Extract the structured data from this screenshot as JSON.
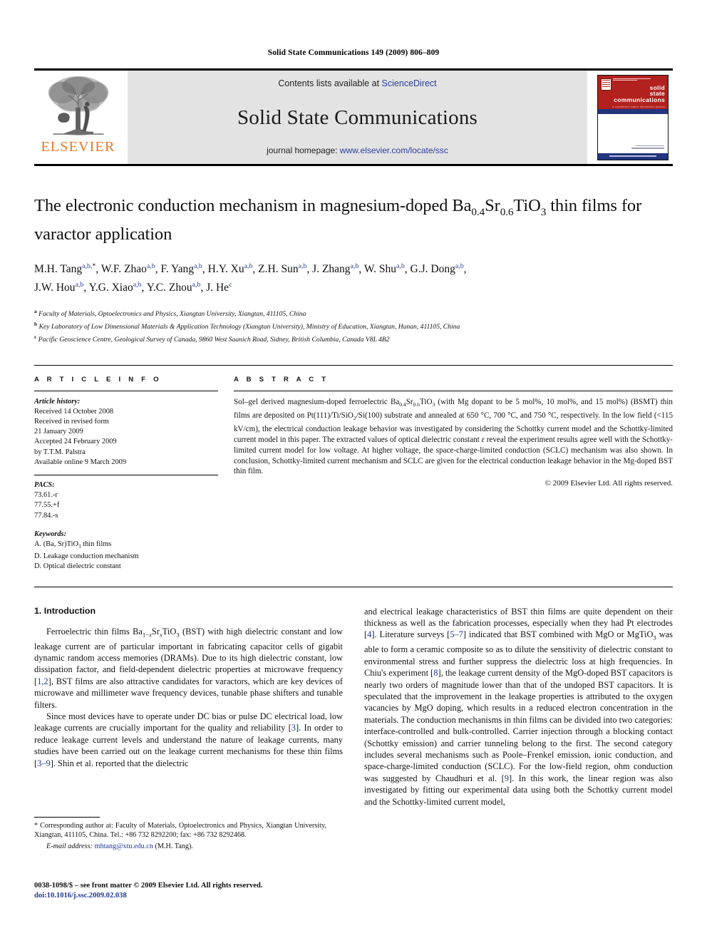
{
  "running_head": "Solid State Communications 149 (2009) 806–809",
  "masthead": {
    "contents_prefix": "Contents lists available at ",
    "contents_link": "ScienceDirect",
    "journal_name": "Solid State Communications",
    "homepage_prefix": "journal homepage: ",
    "homepage_link": "www.elsevier.com/locate/ssc",
    "publisher_logo_text": "ELSEVIER",
    "cover": {
      "line1": "solid",
      "line2": "state",
      "line3": "communications",
      "tagline": "a condensed matter information journal"
    }
  },
  "article": {
    "title_part1": "The electronic conduction mechanism in magnesium-doped Ba",
    "title_sub1": "0.4",
    "title_part2": "Sr",
    "title_sub2": "0.6",
    "title_part3": "TiO",
    "title_sub3": "3",
    "title_part4": " thin films for varactor application",
    "authors": "M.H. Tang a,b,*, W.F. Zhao a,b, F. Yang a,b, H.Y. Xu a,b, Z.H. Sun a,b, J. Zhang a,b, W. Shu a,b, G.J. Dong a,b, J.W. Hou a,b, Y.G. Xiao a,b, Y.C. Zhou a,b, J. He c",
    "affiliations": [
      {
        "marker": "a",
        "text": "Faculty of Materials, Optoelectronics and Physics, Xiangtan University, Xiangtan, 411105, China"
      },
      {
        "marker": "b",
        "text": "Key Laboratory of Low Dimensional Materials & Application Technology (Xiangtan University), Ministry of Education, Xiangtan, Hunan, 411105, China"
      },
      {
        "marker": "c",
        "text": "Pacific Geoscience Centre, Geological Survey of Canada, 9860 West Saanich Road, Sidney, British Columbia, Canada V8L 4B2"
      }
    ]
  },
  "info": {
    "heading": "A R T I C L E   I N F O",
    "history_label": "Article history:",
    "history_lines": [
      "Received 14 October 2008",
      "Received in revised form",
      "21 January 2009",
      "Accepted 24 February 2009",
      "by T.T.M. Palstra",
      "Available online 9 March 2009"
    ],
    "pacs_label": "PACS:",
    "pacs": [
      "73.61.-r",
      "77.55.+f",
      "77.84.-s"
    ],
    "keywords_label": "Keywords:",
    "keywords": [
      "A. (Ba, Sr)TiO3 thin films",
      "D. Leakage conduction mechanism",
      "D. Optical dielectric constant"
    ]
  },
  "abstract": {
    "heading": "A B S T R A C T",
    "text": "Sol–gel derived magnesium-doped ferroelectric Ba0.4Sr0.6TiO3 (with Mg dopant to be 5 mol%, 10 mol%, and 15 mol%) (BSMT) thin films are deposited on Pt(111)/Ti/SiO2/Si(100) substrate and annealed at 650 °C, 700 °C, and 750 °C, respectively. In the low field (<115 kV/cm), the electrical conduction leakage behavior was investigated by considering the Schottky current model and the Schottky-limited current model in this paper. The extracted values of optical dielectric constant ε reveal the experiment results agree well with the Schottky-limited current model for low voltage. At higher voltage, the space-charge-limited conduction (SCLC) mechanism was also shown. In conclusion, Schottky-limited current mechanism and SCLC are given for the electrical conduction leakage behavior in the Mg-doped BST thin film.",
    "copyright": "© 2009 Elsevier Ltd. All rights reserved."
  },
  "body": {
    "section_heading": "1. Introduction",
    "left_paragraphs": [
      "Ferroelectric thin films Ba1−xSrxTiO3 (BST) with high dielectric constant and low leakage current are of particular important in fabricating capacitor cells of gigabit dynamic random access memories (DRAMs). Due to its high dielectric constant, low dissipation factor, and field-dependent dielectric properties at microwave frequency [1,2], BST films are also attractive candidates for varactors, which are key devices of microwave and millimeter wave frequency devices, tunable phase shifters and tunable filters.",
      "Since most devices have to operate under DC bias or pulse DC electrical load, low leakage currents are crucially important for the quality and reliability [3]. In order to reduce leakage current levels and understand the nature of leakage currents, many studies have been carried out on the leakage current mechanisms for these thin films [3–9]. Shin et al. reported that the dielectric"
    ],
    "right_paragraphs": [
      "and electrical leakage characteristics of BST thin films are quite dependent on their thickness as well as the fabrication processes, especially when they had Pt electrodes [4]. Literature surveys [5–7] indicated that BST combined with MgO or MgTiO3 was able to form a ceramic composite so as to dilute the sensitivity of dielectric constant to environmental stress and further suppress the dielectric loss at high frequencies. In Chiu's experiment [8], the leakage current density of the MgO-doped BST capacitors is nearly two orders of magnitude lower than that of the undoped BST capacitors. It is speculated that the improvement in the leakage properties is attributed to the oxygen vacancies by MgO doping, which results in a reduced electron concentration in the materials. The conduction mechanisms in thin films can be divided into two categories: interface-controlled and bulk-controlled. Carrier injection through a blocking contact (Schottky emission) and carrier tunneling belong to the first. The second category includes several mechanisms such as Poole–Frenkel emission, ionic conduction, and space-charge-limited conduction (SCLC). For the low-field region, ohm conduction was suggested by Chaudhuri et al. [9]. In this work, the linear region was also investigated by fitting our experimental data using both the Schottky current model and the Schottky-limited current model,"
    ]
  },
  "footnote": {
    "corresponding": "* Corresponding author at: Faculty of Materials, Optoelectronics and Physics, Xiangtan University, Xiangtan, 411105, China. Tel.: +86 732 8292200; fax: +86 732 8292468.",
    "email_label": "E-mail address:",
    "email": "mhtang@xtu.edu.cn",
    "email_suffix": "(M.H. Tang)."
  },
  "issn": {
    "line1": "0038-1098/$ – see front matter © 2009 Elsevier Ltd. All rights reserved.",
    "doi": "doi:10.1016/j.ssc.2009.02.038"
  },
  "colors": {
    "link": "#2a3f9d",
    "elsevier_orange": "#E87722",
    "cover_red": "#b2211d",
    "cover_blue": "#23357e",
    "masthead_grey": "#e3e3e3"
  }
}
